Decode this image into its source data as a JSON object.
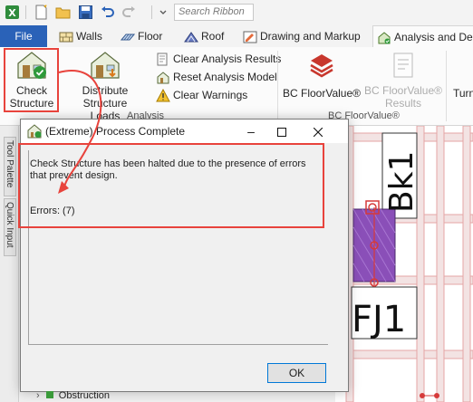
{
  "search": {
    "placeholder": "Search Ribbon"
  },
  "tabs": [
    {
      "label": "File"
    },
    {
      "label": "Walls"
    },
    {
      "label": "Floor"
    },
    {
      "label": "Roof"
    },
    {
      "label": "Drawing and Markup"
    },
    {
      "label": "Analysis and Desi"
    }
  ],
  "ribbon": {
    "check_structure": {
      "line1": "Check",
      "line2": "Structure"
    },
    "distribute_loads": {
      "line1": "Distribute Structure",
      "line2": "Loads"
    },
    "clear_analysis": "Clear Analysis Results",
    "reset_model": "Reset Analysis Model",
    "clear_warnings": "Clear Warnings",
    "analysis_group": "Analysis",
    "bc_floorvalue": "BC FloorValue®",
    "bc_floorvalue_results": {
      "line1": "BC FloorValue®",
      "line2": "Results"
    },
    "floorvalue_group": "BC FloorValue®",
    "turn_partial": "Turn"
  },
  "side_tabs": {
    "tool_palette": "Tool Palette",
    "quick_input": "Quick Input"
  },
  "dialog": {
    "title": "(Extreme) Process Complete",
    "message": "Check Structure has been halted due to the presence of errors that prevent design.",
    "errors": "Errors: (7)",
    "ok_label": "OK"
  },
  "canvas": {
    "label_bk": "Bk1",
    "label_fj": "FJ1"
  },
  "tree": {
    "item": "Obstruction"
  },
  "colors": {
    "file_tab": "#2a62b8",
    "highlight": "#e8433c",
    "beam_fill": "#8a4fb8",
    "canvas_line": "#e4a6a6"
  }
}
